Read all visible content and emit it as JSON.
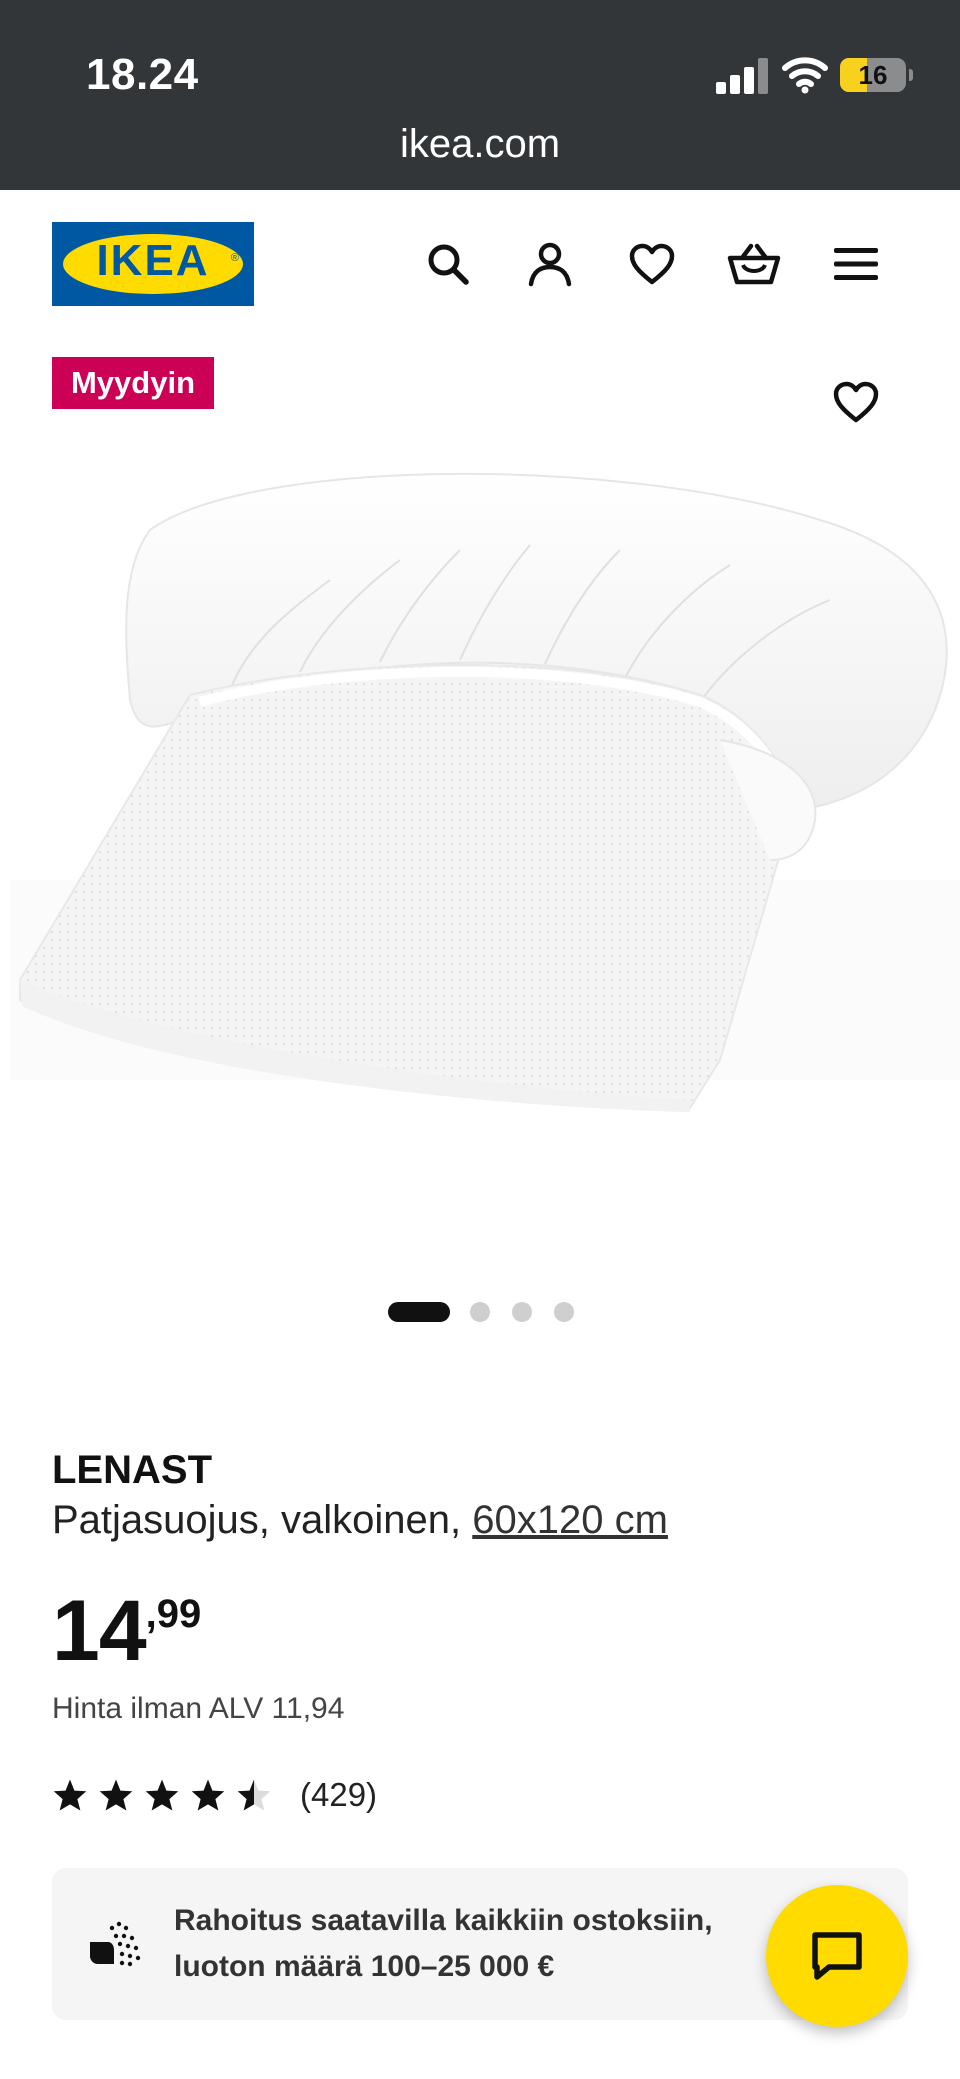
{
  "status_bar": {
    "time": "18.24",
    "battery": "16",
    "battery_color": "#f7d11e"
  },
  "browser": {
    "url": "ikea.com"
  },
  "header": {
    "logo_text": "IKEA",
    "logo_reg": "®",
    "brand_blue": "#0058a3",
    "brand_yellow": "#ffdb00",
    "icons": [
      "search-icon",
      "account-icon",
      "favourites-icon",
      "cart-icon",
      "menu-icon"
    ]
  },
  "product": {
    "badge": "Myydyin",
    "badge_color": "#cc0055",
    "name": "LENAST",
    "description": "Patjasuojus, valkoinen,",
    "size": "60x120 cm",
    "price_integer": "14",
    "price_decimals": ",99",
    "price_ex_vat": "Hinta ilman ALV 11,94",
    "rating": 4.5,
    "rating_max": 5,
    "review_count": "(429)",
    "image_count": 4,
    "active_image": 1
  },
  "financing": {
    "line1": "Rahoitus saatavilla kaikkiin ostoksiin,",
    "line2": "luoton määrä 100–25 000 €"
  },
  "chat": {
    "icon": "chat-icon"
  }
}
